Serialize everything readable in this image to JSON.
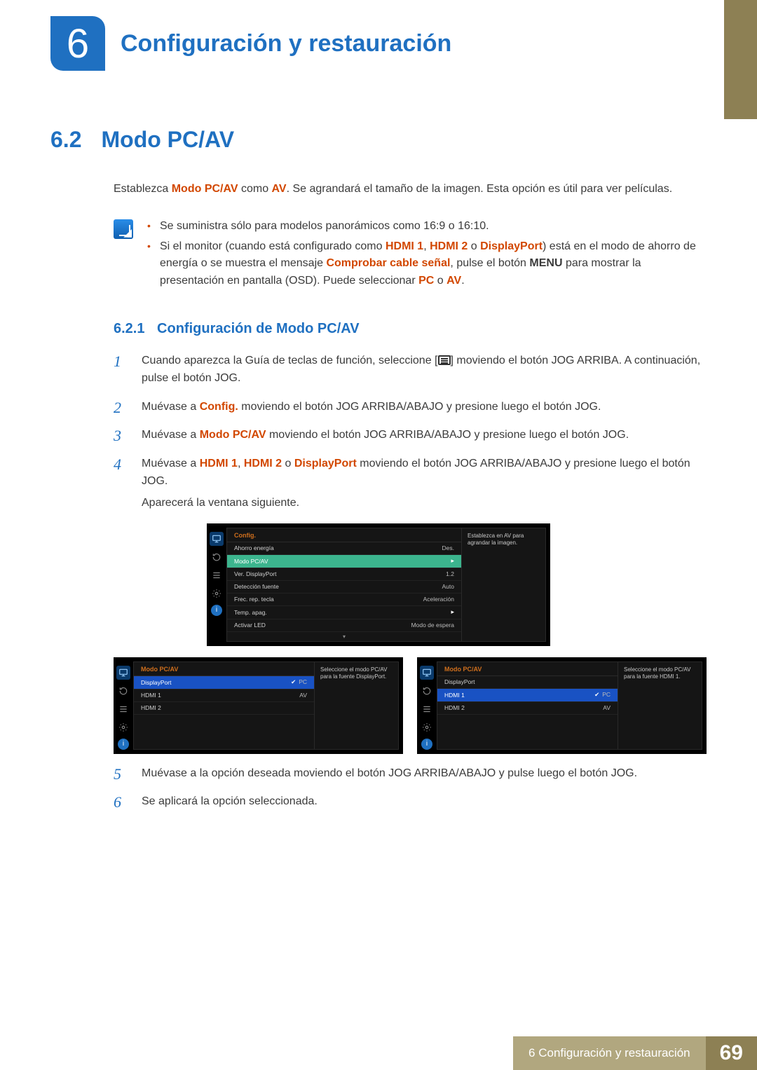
{
  "chapter": {
    "number": "6",
    "title": "Configuración y restauración"
  },
  "section": {
    "number": "6.2",
    "title": "Modo PC/AV"
  },
  "intro": {
    "pre": "Establezca ",
    "hl1": "Modo PC/AV",
    "mid": " como ",
    "hl2": "AV",
    "post": ". Se agrandará el tamaño de la imagen. Esta opción es útil para ver películas."
  },
  "info_bullets": {
    "b1": "Se suministra sólo para modelos panorámicos como 16:9 o 16:10.",
    "b2_pre": "Si el monitor (cuando está configurado como ",
    "b2_hl1": "HDMI 1",
    "b2_sep1": ", ",
    "b2_hl2": "HDMI 2",
    "b2_sep2": " o ",
    "b2_hl3": "DisplayPort",
    "b2_mid1": ") está en el modo de ahorro de energía o se muestra el mensaje ",
    "b2_hl4": "Comprobar cable señal",
    "b2_mid2": ", pulse el botón ",
    "b2_bold": "MENU",
    "b2_mid3": " para mostrar la presentación en pantalla (OSD). Puede seleccionar ",
    "b2_hl5": "PC",
    "b2_sep3": " o ",
    "b2_hl6": "AV",
    "b2_post": "."
  },
  "subsection": {
    "number": "6.2.1",
    "title": "Configuración de Modo PC/AV"
  },
  "steps": {
    "n1": "1",
    "s1a": "Cuando aparezca la Guía de teclas de función, seleccione [",
    "s1b": "] moviendo el botón JOG ARRIBA. A continuación, pulse el botón JOG.",
    "n2": "2",
    "s2_pre": "Muévase a ",
    "s2_hl": "Config.",
    "s2_post": " moviendo el botón JOG ARRIBA/ABAJO y presione luego el botón JOG.",
    "n3": "3",
    "s3_pre": "Muévase a ",
    "s3_hl": "Modo PC/AV",
    "s3_post": " moviendo el botón JOG ARRIBA/ABAJO y presione luego el botón JOG.",
    "n4": "4",
    "s4_pre": "Muévase a ",
    "s4_hl1": "HDMI 1",
    "s4_sep1": ", ",
    "s4_hl2": "HDMI 2",
    "s4_sep2": " o ",
    "s4_hl3": "DisplayPort",
    "s4_post": " moviendo el botón JOG ARRIBA/ABAJO y presione luego el botón JOG.",
    "s4_extra": "Aparecerá la ventana siguiente.",
    "n5": "5",
    "s5": "Muévase a la opción deseada moviendo el botón JOG ARRIBA/ABAJO y pulse luego el botón JOG.",
    "n6": "6",
    "s6": "Se aplicará la opción seleccionada."
  },
  "osd_config": {
    "header": "Config.",
    "desc": "Establezca en AV para agrandar la imagen.",
    "rows": [
      {
        "label": "Ahorro energía",
        "value": "Des."
      },
      {
        "label": "Modo PC/AV",
        "value": "▸",
        "highlight": "green"
      },
      {
        "label": "Ver. DisplayPort",
        "value": "1.2"
      },
      {
        "label": "Detección fuente",
        "value": "Auto"
      },
      {
        "label": "Frec. rep. tecla",
        "value": "Aceleración"
      },
      {
        "label": "Temp. apag.",
        "value": "▸"
      },
      {
        "label": "Activar LED",
        "value": "Modo de espera"
      }
    ]
  },
  "osd_left": {
    "header": "Modo PC/AV",
    "desc": "Seleccione el modo PC/AV para la fuente DisplayPort.",
    "rows": [
      {
        "label": "DisplayPort",
        "value": "PC",
        "highlight": "blue",
        "check": true
      },
      {
        "label": "HDMI 1",
        "value": "AV"
      },
      {
        "label": "HDMI 2",
        "value": ""
      }
    ]
  },
  "osd_right": {
    "header": "Modo PC/AV",
    "desc": "Seleccione el modo PC/AV para la fuente HDMI 1.",
    "rows": [
      {
        "label": "DisplayPort",
        "value": ""
      },
      {
        "label": "HDMI 1",
        "value": "PC",
        "highlight": "blue",
        "check": true
      },
      {
        "label": "HDMI 2",
        "value": "AV"
      }
    ]
  },
  "footer": {
    "label": "6 Configuración y restauración",
    "page": "69"
  }
}
